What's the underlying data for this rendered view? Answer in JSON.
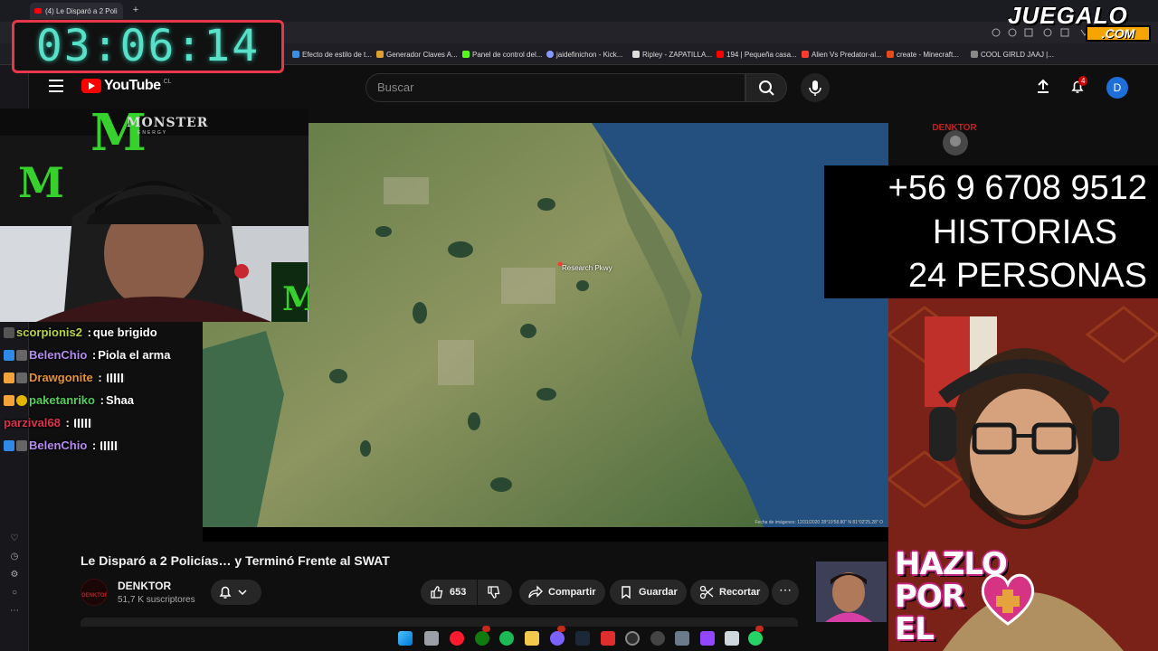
{
  "browser": {
    "tab_title": "(4) Le Disparó a 2 Poli",
    "bookmarks": [
      {
        "label": "Efecto de estilo de t...",
        "color": "#3a8ee6"
      },
      {
        "label": "Generador Claves A...",
        "color": "#e0a030"
      },
      {
        "label": "Panel de control del...",
        "color": "#53fc18"
      },
      {
        "label": "jaidefinichon - Kick...",
        "color": "#8899ff"
      },
      {
        "label": "Ripley - ZAPATILLA...",
        "color": "#dddddd"
      },
      {
        "label": "194 | Pequeña casa...",
        "color": "#ff0000"
      },
      {
        "label": "Alien Vs Predator-al...",
        "color": "#ff3b30"
      },
      {
        "label": "create - Minecraft...",
        "color": "#e64a19"
      },
      {
        "label": "COOL GIRLD JAAJ |...",
        "color": "#888888"
      }
    ]
  },
  "timer": {
    "value": "03:06:14"
  },
  "youtube": {
    "logo_text": "YouTube",
    "logo_country": "CL",
    "search_placeholder": "Buscar",
    "notification_count": "4",
    "user_initial": "D"
  },
  "video": {
    "map_label": "Research Pkwy",
    "map_credit": "Fecha de imágenes: 12/31/2020   28°19'58.80\" N  81°02'25.28\" O"
  },
  "overlay": {
    "phone": "+56 9 6708 9512",
    "line2": "HISTORIAS",
    "line3": "24 PERSONAS",
    "hazlo_line1": "HAZLO",
    "hazlo_line2": "POR",
    "hazlo_line3": "EL",
    "brand_top": "JUEGALO",
    "brand_bottom": ".COM",
    "monster_word": "MONSTER",
    "monster_sub": "ENERGY"
  },
  "chat": [
    {
      "user": "scorpionis2",
      "message": "que brigido",
      "color": "#b8d34a",
      "emote": false
    },
    {
      "user": "BelenChio",
      "message": "Piola el arma",
      "color": "#b58cf0",
      "emote": false
    },
    {
      "user": "Drawgonite",
      "message": "",
      "color": "#e8932f",
      "emote": true
    },
    {
      "user": "paketanriko",
      "message": "Shaa",
      "color": "#53d05a",
      "emote": false
    },
    {
      "user": "parzival68",
      "message": "",
      "color": "#e0324a",
      "emote": true
    },
    {
      "user": "BelenChio",
      "message": "",
      "color": "#b58cf0",
      "emote": true
    }
  ],
  "video_info": {
    "title": "Le Disparó a 2 Policías… y Terminó Frente al SWAT",
    "channel": "DENKTOR",
    "subscribers": "51,7 K suscriptores",
    "likes": "653",
    "share_label": "Compartir",
    "save_label": "Guardar",
    "clip_label": "Recortar"
  },
  "colors": {
    "timer_border": "#e8364a",
    "timer_text": "#58e0c8",
    "youtube_red": "#ff0000",
    "monster_green": "#37d12d",
    "juegalo_orange": "#f5a400"
  }
}
